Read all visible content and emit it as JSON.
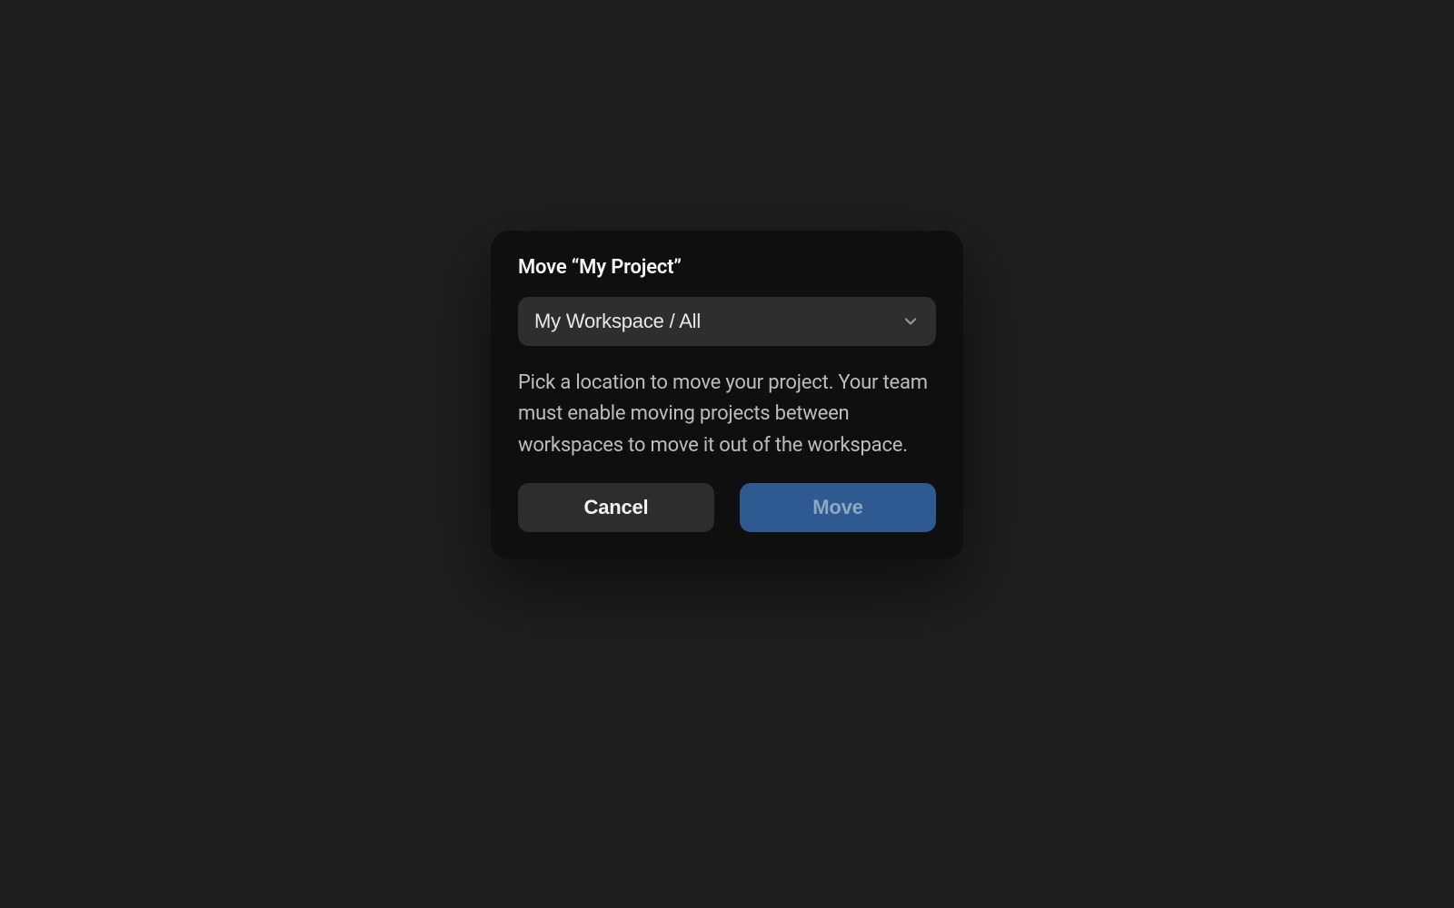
{
  "modal": {
    "title": "Move “My Project”",
    "select": {
      "value": "My Workspace / All"
    },
    "description": "Pick a location to move your project. Your team must enable moving projects between workspaces to move it out of the workspace.",
    "buttons": {
      "cancel": "Cancel",
      "move": "Move"
    }
  }
}
